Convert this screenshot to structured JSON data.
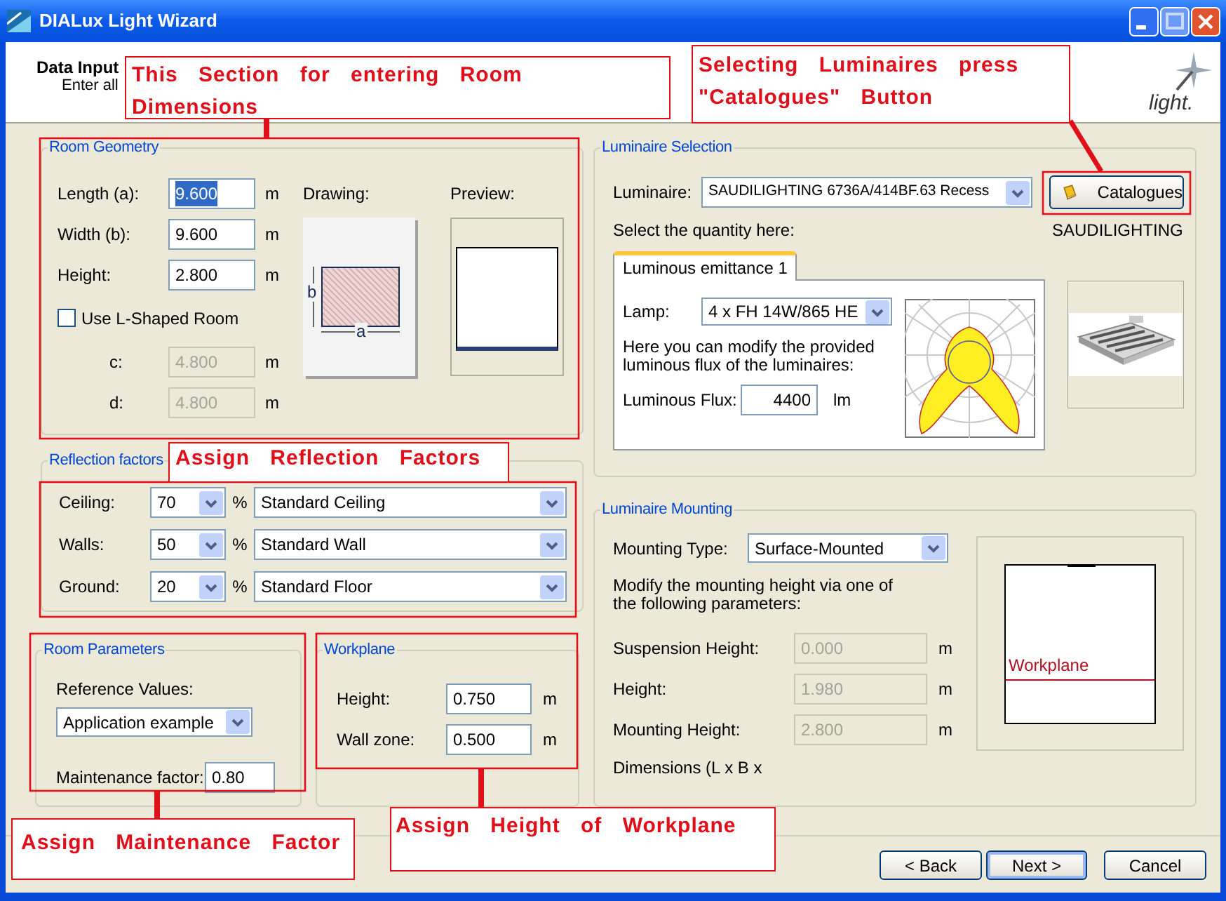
{
  "window": {
    "title": "DIALux Light Wizard"
  },
  "header": {
    "title": "Data Input",
    "subtitle": "Enter all",
    "logo_text": "light."
  },
  "room_geometry": {
    "title": "Room Geometry",
    "fields": [
      {
        "label": "Length (a):",
        "value": "9.600",
        "unit": "m",
        "text_highlighted": true
      },
      {
        "label": "Width (b):",
        "value": "9.600",
        "unit": "m",
        "text_highlighted": false
      },
      {
        "label": "Height:",
        "value": "2.800",
        "unit": "m",
        "text_highlighted": false
      }
    ],
    "l_shaped": {
      "label": "Use L-Shaped Room",
      "checked": false
    },
    "l_fields": [
      {
        "label": "c:",
        "value": "4.800",
        "unit": "m",
        "disabled": true
      },
      {
        "label": "d:",
        "value": "4.800",
        "unit": "m",
        "disabled": true
      }
    ],
    "drawing_label": "Drawing:",
    "drawing_marks": [
      "b",
      "a"
    ],
    "preview_label": "Preview:"
  },
  "reflection_factors": {
    "title": "Reflection factors",
    "rows": [
      {
        "label": "Ceiling:",
        "percent": "70",
        "unit": "%",
        "material": "Standard Ceiling"
      },
      {
        "label": "Walls:",
        "percent": "50",
        "unit": "%",
        "material": "Standard Wall"
      },
      {
        "label": "Ground:",
        "percent": "20",
        "unit": "%",
        "material": "Standard Floor"
      }
    ]
  },
  "room_parameters": {
    "title": "Room Parameters",
    "reference_label": "Reference Values:",
    "reference_value": "Application example",
    "maintenance_label": "Maintenance factor:",
    "maintenance_value": "0.80"
  },
  "workplane": {
    "title": "Workplane",
    "fields": [
      {
        "label": "Height:",
        "value": "0.750",
        "unit": "m"
      },
      {
        "label": "Wall zone:",
        "value": "0.500",
        "unit": "m"
      }
    ]
  },
  "luminaire_selection": {
    "title": "Luminaire Selection",
    "luminaire_label": "Luminaire:",
    "luminaire_value": "SAUDILIGHTING 6736A/414BF.63 Recess",
    "catalogues_button": "Catalogues",
    "quantity_label": "Select the quantity here:",
    "manufacturer": "SAUDILIGHTING",
    "tabs": [
      {
        "label": "Luminous emittance 1",
        "selected": true
      }
    ],
    "lamp_label": "Lamp:",
    "lamp_value": "4 x FH 14W/865 HE",
    "flux_note": "Here you can modify the provided luminous flux of the luminaires:",
    "flux_label": "Luminous Flux:",
    "flux_value": "4400",
    "flux_unit": "lm"
  },
  "luminaire_mounting": {
    "title": "Luminaire Mounting",
    "type_label": "Mounting Type:",
    "type_value": "Surface-Mounted",
    "note": "Modify the mounting height via one of the following parameters:",
    "fields": [
      {
        "label": "Suspension Height:",
        "value": "0.000",
        "unit": "m",
        "disabled": true
      },
      {
        "label": "Height:",
        "value": "1.980",
        "unit": "m",
        "disabled": true
      },
      {
        "label": "Mounting Height:",
        "value": "2.800",
        "unit": "m",
        "disabled": true
      }
    ],
    "dimensions_label": "Dimensions (L x B x",
    "preview_label": "Workplane"
  },
  "buttons": [
    {
      "label": "< Back",
      "default": false
    },
    {
      "label": "Next >",
      "default": true
    },
    {
      "label": "Cancel",
      "default": false
    }
  ],
  "annotations": [
    {
      "text": "This Section for entering Room Dimensions"
    },
    {
      "text": "Selecting Luminaires press \"Catalogues\" Button"
    },
    {
      "text": "Assign Reflection Factors"
    },
    {
      "text": "Assign Maintenance Factor"
    },
    {
      "text": "Assign Height of Workplane"
    }
  ]
}
